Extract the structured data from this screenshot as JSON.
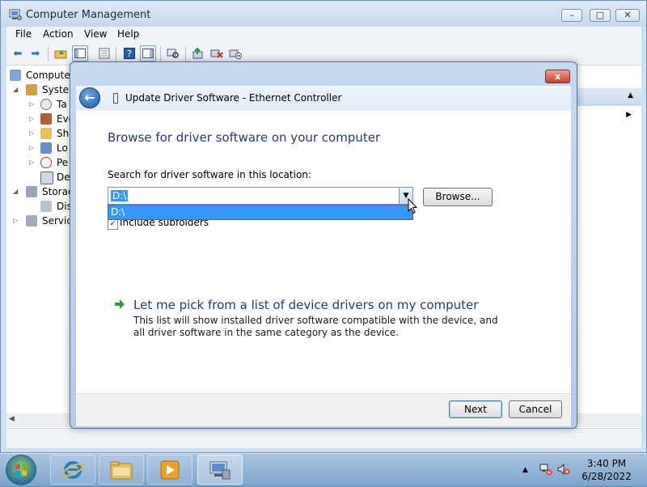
{
  "window": {
    "title": "Computer Management",
    "menu": [
      "File",
      "Action",
      "View",
      "Help"
    ]
  },
  "tree": {
    "items": [
      {
        "label": "Computer",
        "icon": "computer-icon"
      },
      {
        "label": "System",
        "icon": "tools-icon"
      },
      {
        "label": "Ta",
        "icon": "clock-icon"
      },
      {
        "label": "Eve",
        "icon": "event-viewer-icon"
      },
      {
        "label": "Sh",
        "icon": "shared-folders-icon"
      },
      {
        "label": "Lo",
        "icon": "users-icon"
      },
      {
        "label": "Pe",
        "icon": "performance-icon"
      },
      {
        "label": "De",
        "icon": "device-manager-icon"
      },
      {
        "label": "Storag",
        "icon": "storage-icon"
      },
      {
        "label": "Dis",
        "icon": "disk-icon"
      },
      {
        "label": "Service",
        "icon": "services-icon"
      }
    ]
  },
  "dialog": {
    "title": "Update Driver Software - Ethernet Controller",
    "heading": "Browse for driver software on your computer",
    "search_label": "Search for driver software in this location:",
    "path_value": "D:\\",
    "dropdown_option": "D:\\",
    "browse_label": "Browse...",
    "include_subfolders_label": "Include subfolders",
    "include_subfolders_checked": true,
    "pick_title": "Let me pick from a list of device drivers on my computer",
    "pick_desc": "This list will show installed driver software compatible with the device, and all driver software in the same category as the device.",
    "next_label": "Next",
    "cancel_label": "Cancel",
    "close_label": "x"
  },
  "taskbar": {
    "apps": [
      "internet-explorer-icon",
      "windows-explorer-icon",
      "media-player-icon",
      "computer-management-icon"
    ],
    "time": "3:40 PM",
    "date": "6/28/2022"
  },
  "colors": {
    "heading_blue": "#1f3e7a",
    "selection_blue": "#3399ff",
    "close_red": "#c3432f"
  }
}
